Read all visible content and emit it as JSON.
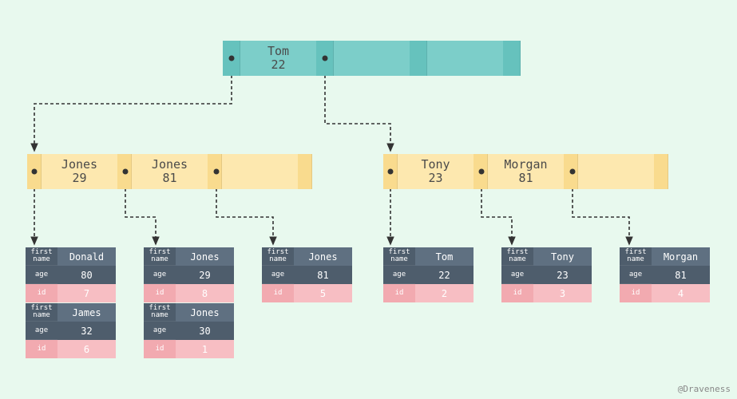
{
  "credit": "@Draveness",
  "root": {
    "keys": [
      {
        "name": "Tom",
        "value": "22"
      },
      {
        "name": "",
        "value": ""
      },
      {
        "name": "",
        "value": ""
      }
    ]
  },
  "internal": {
    "left": {
      "keys": [
        {
          "name": "Jones",
          "value": "29"
        },
        {
          "name": "Jones",
          "value": "81"
        },
        {
          "name": "",
          "value": ""
        }
      ]
    },
    "right": {
      "keys": [
        {
          "name": "Tony",
          "value": "23"
        },
        {
          "name": "Morgan",
          "value": "81"
        },
        {
          "name": "",
          "value": ""
        }
      ]
    }
  },
  "leaves": [
    {
      "records": [
        {
          "first_name": "Donald",
          "age": "80",
          "id": "7"
        },
        {
          "first_name": "James",
          "age": "32",
          "id": "6"
        }
      ]
    },
    {
      "records": [
        {
          "first_name": "Jones",
          "age": "29",
          "id": "8"
        },
        {
          "first_name": "Jones",
          "age": "30",
          "id": "1"
        }
      ]
    },
    {
      "records": [
        {
          "first_name": "Jones",
          "age": "81",
          "id": "5"
        }
      ]
    },
    {
      "records": [
        {
          "first_name": "Tom",
          "age": "22",
          "id": "2"
        }
      ]
    },
    {
      "records": [
        {
          "first_name": "Tony",
          "age": "23",
          "id": "3"
        }
      ]
    },
    {
      "records": [
        {
          "first_name": "Morgan",
          "age": "81",
          "id": "4"
        }
      ]
    }
  ],
  "labels": {
    "first_name": "first\nname",
    "age": "age",
    "id": "id"
  }
}
